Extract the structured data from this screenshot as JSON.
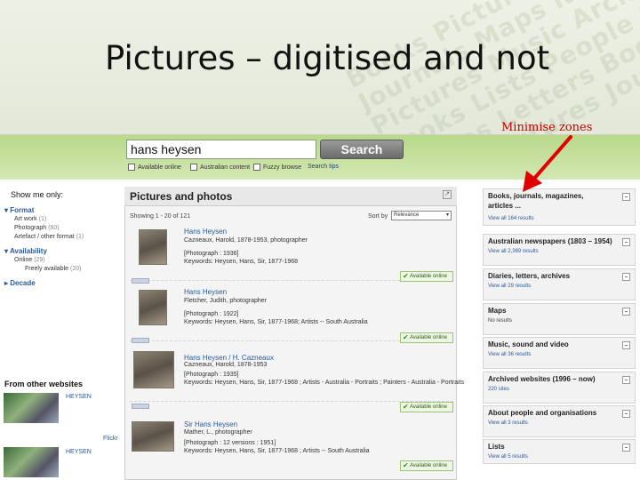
{
  "slide": {
    "title": "Pictures – digitised and not",
    "annotation": "Minimise zones"
  },
  "search": {
    "query": "hans heysen",
    "button": "Search",
    "options": [
      "Available online",
      "Australian content",
      "Fuzzy browse"
    ],
    "tips": "Search tips"
  },
  "sidebar": {
    "show_only": "Show me only:",
    "facets": [
      {
        "heading": "Format",
        "items": [
          {
            "label": "Art work",
            "count": "(1)"
          },
          {
            "label": "Photograph",
            "count": "(60)"
          },
          {
            "label": "Artefact / other format",
            "count": "(1)"
          }
        ]
      },
      {
        "heading": "Availability",
        "items": [
          {
            "label": "Online",
            "count": "(29)"
          },
          {
            "label": "Freely available",
            "count": "(20)"
          }
        ]
      },
      {
        "heading": "Decade",
        "items": []
      }
    ],
    "from_other": "From other websites",
    "other_sites": [
      "HEYSEN",
      "HEYSEN"
    ],
    "flickr": "Flickr"
  },
  "main": {
    "title": "Pictures and photos",
    "showing": "Showing 1 - 20 of 121",
    "sort_label": "Sort by",
    "sort_value": "Relevance",
    "results": [
      {
        "name": "Hans Heysen",
        "creator": "Cazneaux, Harold, 1878-1953, photographer",
        "format": "[Photograph : 1936]",
        "keywords": "Keywords: Heysen, Hans, Sir, 1877-1968",
        "badge": "Available online"
      },
      {
        "name": "Hans Heysen",
        "creator": "Fletcher, Judith, photographer",
        "format": "[Photograph : 1922]",
        "keywords": "Keywords: Heysen, Hans, Sir, 1877-1968; Artists -- South Australia",
        "badge": "Available online"
      },
      {
        "name": "Hans Heysen / H. Cazneaux",
        "creator": "Cazneaux, Harold, 1878-1953",
        "format": "[Photograph : 1935]",
        "keywords": "Keywords: Heysen, Hans, Sir, 1877-1968 ; Artists - Australia - Portraits ; Painters - Australia - Portraits",
        "badge": "Available online"
      },
      {
        "name": "Sir Hans Heysen",
        "creator": "Mather, L., photographer",
        "format": "[Photograph : 12 versions : 1951]",
        "keywords": "Keywords: Heysen, Hans, Sir, 1877-1968 ; Artists -- South Australia",
        "badge": "Available online"
      }
    ]
  },
  "zones": [
    {
      "title": "Books, journals, magazines,",
      "title2": "articles ...",
      "sub": "View all 164 results"
    },
    {
      "title": "Australian newspapers (1803 – 1954)",
      "sub": "View all 2,369 results"
    },
    {
      "title": "Diaries, letters, archives",
      "sub": "View all 29 results"
    },
    {
      "title": "Maps",
      "sub": "No results"
    },
    {
      "title": "Music, sound and video",
      "sub": "View all 36 results"
    },
    {
      "title": "Archived websites (1996 – now)",
      "sub": "220 sites"
    },
    {
      "title": "About people and organisations",
      "sub": "View all 3 results"
    },
    {
      "title": "Lists",
      "sub": "View all 5 results"
    }
  ],
  "colors": {
    "arrow": "#e00000",
    "search_band": "#c3df98",
    "link": "#2a5a9a"
  }
}
